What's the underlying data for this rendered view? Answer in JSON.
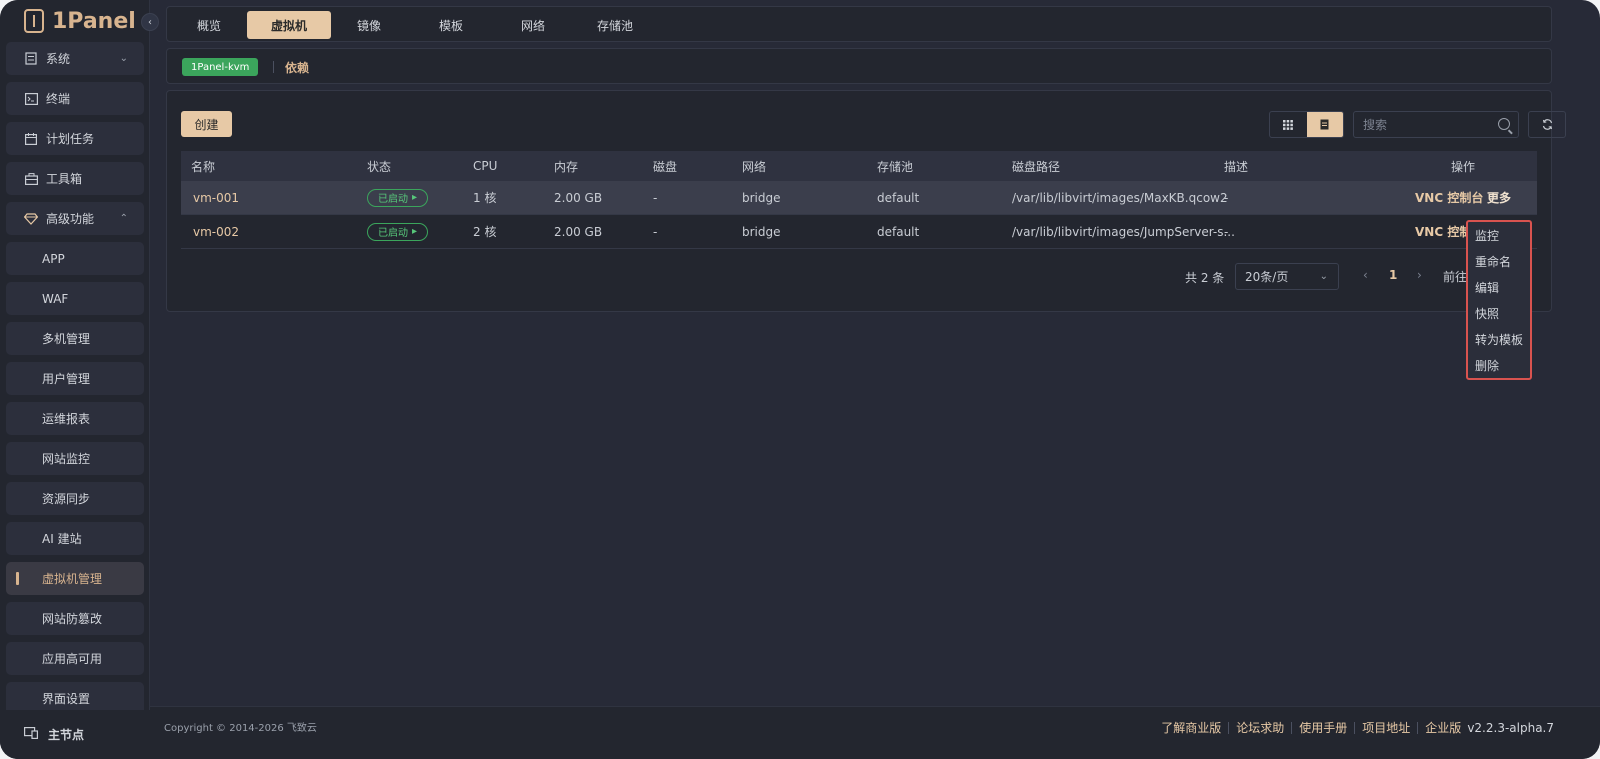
{
  "brand": {
    "name": "1Panel"
  },
  "sidebar": {
    "items": [
      {
        "label": "系统",
        "icon": "system-icon",
        "expandable": true,
        "expanded": false
      },
      {
        "label": "终端",
        "icon": "terminal-icon"
      },
      {
        "label": "计划任务",
        "icon": "calendar-icon"
      },
      {
        "label": "工具箱",
        "icon": "toolbox-icon"
      },
      {
        "label": "高级功能",
        "icon": "diamond-icon",
        "expandable": true,
        "expanded": true
      }
    ],
    "sub_items": [
      "APP",
      "WAF",
      "多机管理",
      "用户管理",
      "运维报表",
      "网站监控",
      "资源同步",
      "AI 建站",
      "虚拟机管理",
      "网站防篡改",
      "应用高可用",
      "界面设置"
    ],
    "active": "虚拟机管理",
    "footer_label": "主节点"
  },
  "tabs": [
    "概览",
    "虚拟机",
    "镜像",
    "模板",
    "网络",
    "存储池"
  ],
  "active_tab": "虚拟机",
  "subbar": {
    "badge": "1Panel-kvm",
    "link": "依赖"
  },
  "toolbar": {
    "create_label": "创建",
    "search_placeholder": "搜索"
  },
  "table": {
    "headers": [
      "名称",
      "状态",
      "CPU",
      "内存",
      "磁盘",
      "网络",
      "存储池",
      "磁盘路径",
      "描述",
      "操作"
    ],
    "rows": [
      {
        "name": "vm-001",
        "status": "已启动",
        "cpu": "1 核",
        "memory": "2.00 GB",
        "disk": "-",
        "network": "bridge",
        "pool": "default",
        "path": "/var/lib/libvirt/images/MaxKB.qcow2",
        "desc": "-",
        "op_vnc": "VNC 控制台",
        "op_more": "更多"
      },
      {
        "name": "vm-002",
        "status": "已启动",
        "cpu": "2 核",
        "memory": "2.00 GB",
        "disk": "-",
        "network": "bridge",
        "pool": "default",
        "path": "/var/lib/libvirt/images/JumpServer-s...",
        "desc": "-",
        "op_vnc": "VNC 控制",
        "op_more": ""
      }
    ]
  },
  "pager": {
    "total": "共 2 条",
    "page_size": "20条/页",
    "current": "1",
    "goto": "前往"
  },
  "dropdown": [
    "监控",
    "重命名",
    "编辑",
    "快照",
    "转为模板",
    "删除"
  ],
  "footer": {
    "copyright": "Copyright © 2014-2026 飞致云",
    "links": [
      "了解商业版",
      "论坛求助",
      "使用手册",
      "项目地址"
    ],
    "edition": "企业版",
    "version": "v2.2.3-alpha.7"
  },
  "colors": {
    "accent": "#e7c9a6",
    "success": "#3ba55c",
    "highlight_border": "#d9534f",
    "bg": "#272a37"
  }
}
